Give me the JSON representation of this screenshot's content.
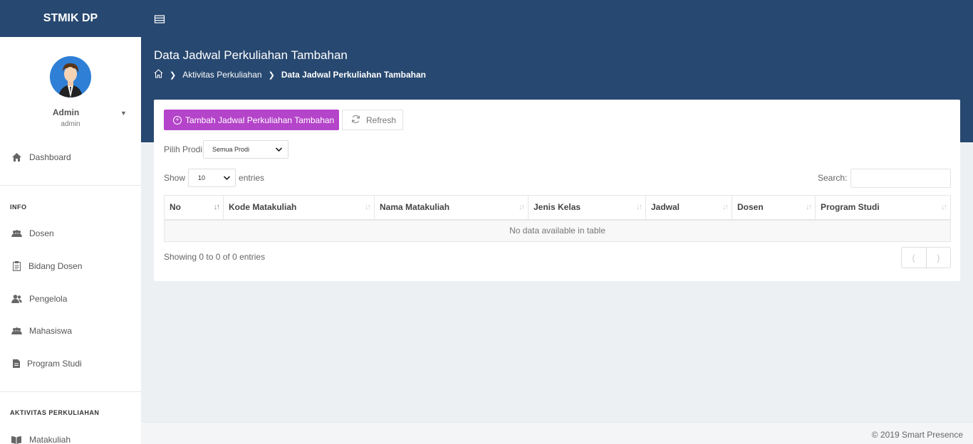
{
  "app": {
    "brand": "STMIK DP"
  },
  "profile": {
    "name": "Admin",
    "role": "admin"
  },
  "sidebar": {
    "dashboard": "Dashboard",
    "info_label": "INFO",
    "info_items": [
      "Dosen",
      "Bidang Dosen",
      "Pengelola",
      "Mahasiswa",
      "Program Studi"
    ],
    "aktivitas_label": "AKTIVITAS PERKULIAHAN",
    "aktivitas_items": [
      "Matakuliah"
    ]
  },
  "header": {
    "title": "Data Jadwal Perkuliahan Tambahan",
    "breadcrumb": [
      "Aktivitas Perkuliahan",
      "Data Jadwal Perkuliahan Tambahan"
    ]
  },
  "toolbar": {
    "add_label": "Tambah Jadwal Perkuliahan Tambahan",
    "refresh_label": "Refresh"
  },
  "filter": {
    "label": "Pilih Prodi",
    "selected": "Semua Prodi"
  },
  "table_controls": {
    "show_label": "Show",
    "length_value": "10",
    "entries_label": "entries",
    "search_label": "Search:"
  },
  "table": {
    "columns": [
      "No",
      "Kode Matakuliah",
      "Nama Matakuliah",
      "Jenis Kelas",
      "Jadwal",
      "Dosen",
      "Program Studi"
    ],
    "empty_message": "No data available in table",
    "info": "Showing 0 to 0 of 0 entries"
  },
  "pagination": {
    "prev": "(",
    "next": ")"
  },
  "footer": {
    "text": "© 2019 Smart Presence"
  },
  "colors": {
    "header_bg": "#274870",
    "add_button": "#b444c9",
    "page_bg": "#edf0f3"
  }
}
